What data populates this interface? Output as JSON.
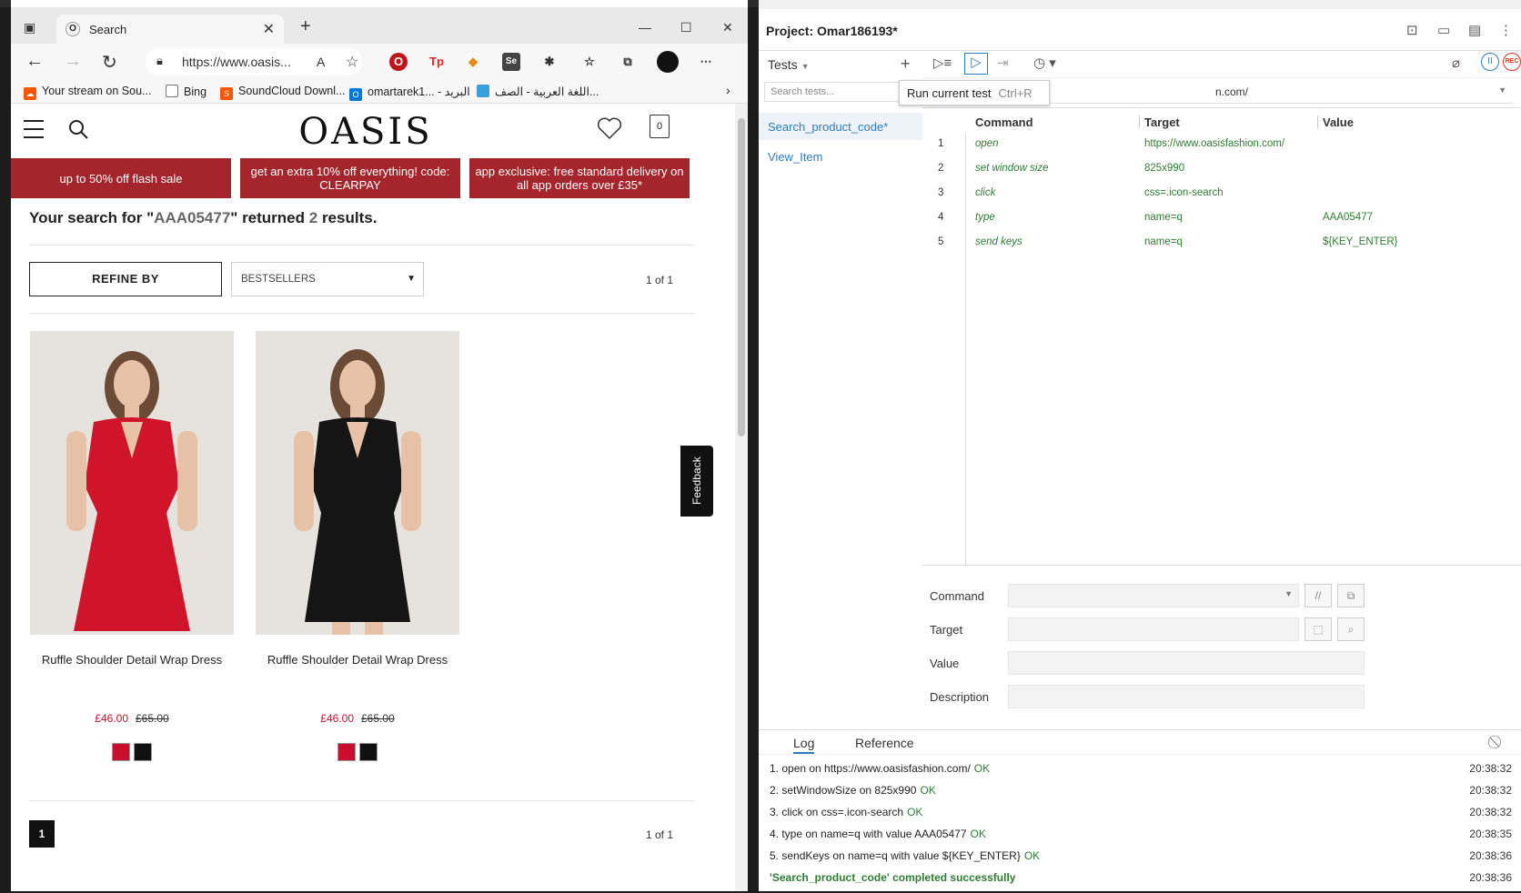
{
  "browser": {
    "tab_title": "Search",
    "url": "https://www.oasis...",
    "bookmarks": [
      {
        "label": "Your stream on Sou...",
        "color": "#ff5500"
      },
      {
        "label": "Bing",
        "color": "#777777"
      },
      {
        "label": "SoundCloud Downl...",
        "color": "#ff5500"
      },
      {
        "label": "omartarek1... - البريد",
        "color": "#0078d4"
      },
      {
        "label": "اللغة العربية - الصف...",
        "color": "#3aa0d8"
      }
    ]
  },
  "site": {
    "logo": "OASIS",
    "bag_count": "0",
    "promos": [
      "up to 50% off flash sale",
      "get an extra 10% off everything! code: CLEARPAY",
      "app exclusive: free standard delivery on all app orders over £35*"
    ],
    "result_pre": "Your search for \"",
    "result_term": "AAA05477",
    "result_mid": "\" returned ",
    "result_count": "2",
    "result_post": " results.",
    "refine_label": "REFINE BY",
    "sort_value": "BESTSELLERS",
    "page_count_top": "1 of 1",
    "page_count_bottom": "1 of 1",
    "current_page": "1",
    "feedback_label": "Feedback",
    "products": [
      {
        "name": "Ruffle Shoulder Detail Wrap Dress",
        "price_now": "£46.00",
        "price_was": "£65.00",
        "dress_color": "#d0142a",
        "swatches": [
          "#c8102e",
          "#111111"
        ]
      },
      {
        "name": "Ruffle Shoulder Detail Wrap Dress",
        "price_now": "£46.00",
        "price_was": "£65.00",
        "dress_color": "#151515",
        "swatches": [
          "#c8102e",
          "#111111"
        ]
      }
    ]
  },
  "ide": {
    "project_label": "Project:",
    "project_name": "Omar186193*",
    "tests_label": "Tests",
    "search_placeholder": "Search tests...",
    "tests": [
      "Search_product_code*",
      "View_Item"
    ],
    "tooltip": "Run current test",
    "tooltip_key": "Ctrl+R",
    "base_url_tail": "n.com/",
    "columns": [
      "Command",
      "Target",
      "Value"
    ],
    "commands": [
      {
        "n": "1",
        "command": "open",
        "target": "https://www.oasisfashion.com/",
        "value": ""
      },
      {
        "n": "2",
        "command": "set window size",
        "target": "825x990",
        "value": ""
      },
      {
        "n": "3",
        "command": "click",
        "target": "css=.icon-search",
        "value": ""
      },
      {
        "n": "4",
        "command": "type",
        "target": "name=q",
        "value": "AAA05477"
      },
      {
        "n": "5",
        "command": "send keys",
        "target": "name=q",
        "value": "${KEY_ENTER}"
      }
    ],
    "editor": {
      "command_label": "Command",
      "target_label": "Target",
      "value_label": "Value",
      "description_label": "Description"
    },
    "log_tabs": [
      "Log",
      "Reference"
    ],
    "log": [
      {
        "text": "1.  open on https://www.oasisfashion.com/",
        "status": "OK",
        "time": "20:38:32"
      },
      {
        "text": "2.  setWindowSize on 825x990",
        "status": "OK",
        "time": "20:38:32"
      },
      {
        "text": "3.  click on css=.icon-search",
        "status": "OK",
        "time": "20:38:32"
      },
      {
        "text": "4.  type on name=q with value AAA05477",
        "status": "OK",
        "time": "20:38:35"
      },
      {
        "text": "5.  sendKeys on name=q with value ${KEY_ENTER}",
        "status": "OK",
        "time": "20:38:36"
      }
    ],
    "success_text": "'Search_product_code' completed successfully",
    "success_time": "20:38:36",
    "accent": "#2f7dbd",
    "ok_color": "#2e7d32"
  }
}
